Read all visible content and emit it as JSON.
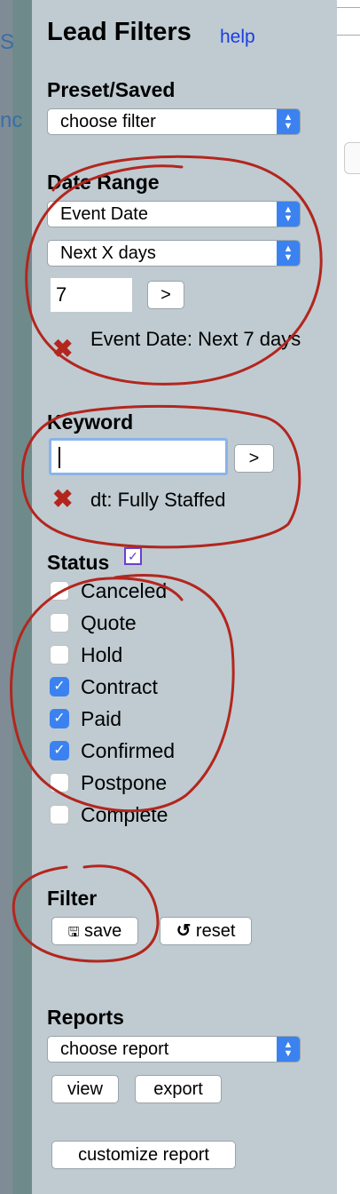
{
  "panel": {
    "title": "Lead Filters",
    "help_label": "help"
  },
  "preset": {
    "label": "Preset/Saved",
    "selected": "choose filter"
  },
  "date_range": {
    "label": "Date Range",
    "date_field": "Event Date",
    "range_type": "Next X days",
    "days_value": "7",
    "go_label": ">",
    "active_filter": "Event Date: Next 7 days"
  },
  "keyword": {
    "label": "Keyword",
    "value": "",
    "go_label": ">",
    "active_filter": "dt: Fully Staffed"
  },
  "status": {
    "label": "Status",
    "items": [
      {
        "label": "Canceled",
        "checked": false
      },
      {
        "label": "Quote",
        "checked": false
      },
      {
        "label": "Hold",
        "checked": false
      },
      {
        "label": "Contract",
        "checked": true
      },
      {
        "label": "Paid",
        "checked": true
      },
      {
        "label": "Confirmed",
        "checked": true
      },
      {
        "label": "Postpone",
        "checked": false
      },
      {
        "label": "Complete",
        "checked": false
      }
    ]
  },
  "filter": {
    "label": "Filter",
    "save_label": "save",
    "reset_label": "reset"
  },
  "reports": {
    "label": "Reports",
    "selected": "choose report",
    "view_label": "view",
    "export_label": "export",
    "customize_label": "customize report"
  },
  "background": {
    "left_text_1": "S",
    "left_text_2": "nc"
  },
  "colors": {
    "panel_bg": "#bfcbd1",
    "link": "#1a3ee0",
    "checkbox_accent": "#3b82f0",
    "annotation_red": "#b3261e"
  }
}
